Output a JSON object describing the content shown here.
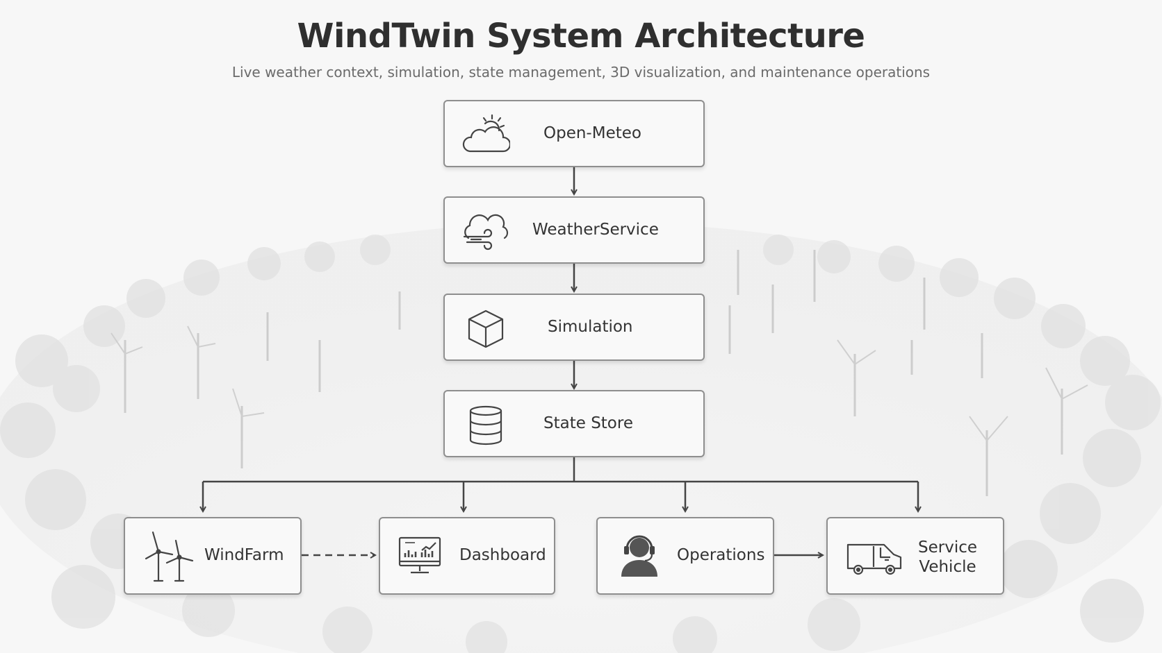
{
  "title": "WindTwin System Architecture",
  "subtitle": "Live weather context, simulation, state management, 3D visualization, and maintenance operations",
  "nodes": {
    "open_meteo": {
      "label": "Open-Meteo",
      "icon": "cloud-sun-icon"
    },
    "weather_service": {
      "label": "WeatherService",
      "icon": "cloud-wind-icon"
    },
    "simulation": {
      "label": "Simulation",
      "icon": "cube-icon"
    },
    "state_store": {
      "label": "State Store",
      "icon": "database-icon"
    },
    "windfarm": {
      "label": "WindFarm",
      "icon": "wind-turbine-icon"
    },
    "dashboard": {
      "label": "Dashboard",
      "icon": "monitor-chart-icon"
    },
    "operations": {
      "label": "Operations",
      "icon": "headset-operator-icon"
    },
    "service_vehicle": {
      "label_line1": "Service",
      "label_line2": "Vehicle",
      "icon": "van-icon"
    }
  },
  "colors": {
    "box_border": "#8e8e8e",
    "connector": "#444444",
    "background": "#f6f6f6"
  }
}
